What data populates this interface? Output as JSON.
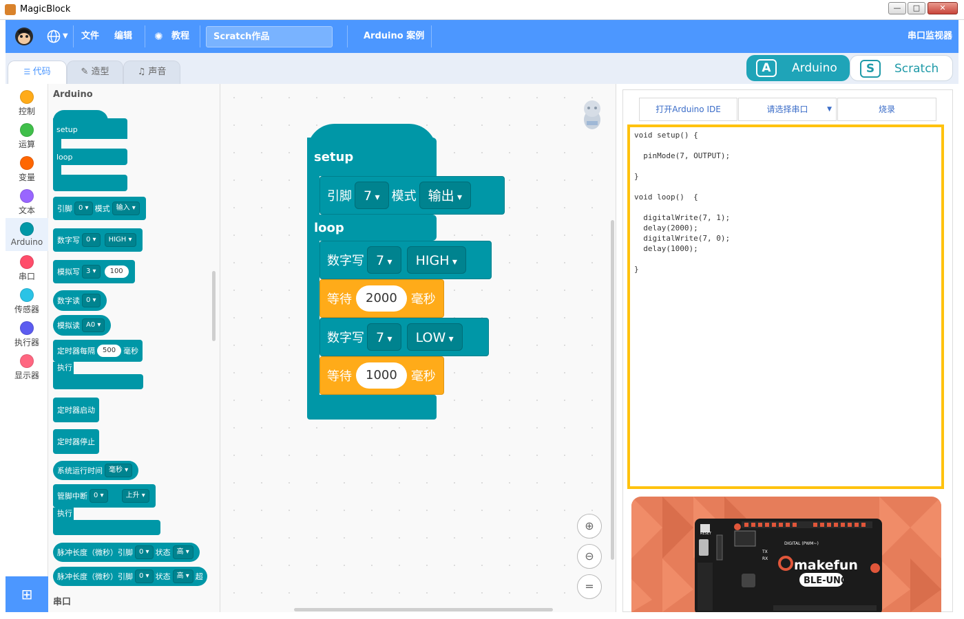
{
  "app": {
    "title": "MagicBlock"
  },
  "menu": {
    "file": "文件",
    "edit": "编辑",
    "tutorial": "教程",
    "scratch_project": "Scratch作品",
    "arduino_examples": "Arduino 案例",
    "serial_monitor": "串口监视器"
  },
  "tabs": [
    {
      "label": "代码"
    },
    {
      "label": "造型"
    },
    {
      "label": "声音"
    }
  ],
  "mode": {
    "arduino": "Arduino",
    "scratch": "Scratch"
  },
  "categories": [
    {
      "label": "控制",
      "color": "#ffab19"
    },
    {
      "label": "运算",
      "color": "#40bf4a"
    },
    {
      "label": "变量",
      "color": "#ff6600"
    },
    {
      "label": "文本",
      "color": "#9966ff"
    },
    {
      "label": "Arduino",
      "color": "#0097a7"
    },
    {
      "label": "串口",
      "color": "#ff4d6a"
    },
    {
      "label": "传感器",
      "color": "#2bc3e6"
    },
    {
      "label": "执行器",
      "color": "#5c5cf0"
    },
    {
      "label": "显示器",
      "color": "#ff6680"
    }
  ],
  "palette": {
    "heading": "Arduino",
    "heading2": "串口",
    "setup": "setup",
    "loop": "loop",
    "pin_mode": {
      "label": "引脚",
      "pin": "0",
      "mode_label": "模式",
      "mode": "输入"
    },
    "digital_write": {
      "label": "数字写",
      "pin": "0",
      "value": "HIGH"
    },
    "analog_write": {
      "label": "模拟写",
      "pin": "3",
      "value": "100"
    },
    "digital_read": {
      "label": "数字读",
      "pin": "0"
    },
    "analog_read": {
      "label": "模拟读",
      "pin": "A0"
    },
    "timer": {
      "label": "定时器每隔",
      "value": "500",
      "unit": "毫秒",
      "exec": "执行"
    },
    "timer_start": "定时器启动",
    "timer_stop": "定时器停止",
    "runtime": {
      "label": "系统运行时间",
      "unit": "毫秒"
    },
    "interrupt": {
      "label": "管脚中断",
      "pin": "0",
      "edge": "上升",
      "exec": "执行"
    },
    "pulse1": {
      "label": "脉冲长度（微秒）引脚",
      "pin": "0",
      "state_label": "状态",
      "state": "高"
    },
    "pulse2": {
      "label": "脉冲长度（微秒）引脚",
      "pin": "0",
      "state_label": "状态",
      "state": "高",
      "extra": "超"
    }
  },
  "workspace": {
    "setup": "setup",
    "loop": "loop",
    "pin_block": {
      "label": "引脚",
      "pin": "7",
      "mode_label": "模式",
      "mode": "输出"
    },
    "write1": {
      "label": "数字写",
      "pin": "7",
      "value": "HIGH"
    },
    "wait1": {
      "label": "等待",
      "value": "2000",
      "unit": "毫秒"
    },
    "write2": {
      "label": "数字写",
      "pin": "7",
      "value": "LOW"
    },
    "wait2": {
      "label": "等待",
      "value": "1000",
      "unit": "毫秒"
    }
  },
  "right": {
    "open_ide": "打开Arduino IDE",
    "port": "请选择串口",
    "upload": "烧录",
    "code": "void setup() {\n\n  pinMode(7, OUTPUT);\n\n}\n\nvoid loop()  {\n\n  digitalWrite(7, 1);\n  delay(2000);\n  digitalWrite(7, 0);\n  delay(1000);\n\n}"
  },
  "board": {
    "brand": "makefun",
    "model": "BLE-UNO",
    "label_digital": "DIGITAL (PWM~)",
    "label_reset": "RESET",
    "label_aref": "AREF",
    "label_tx": "TX",
    "label_rx": "RX"
  }
}
